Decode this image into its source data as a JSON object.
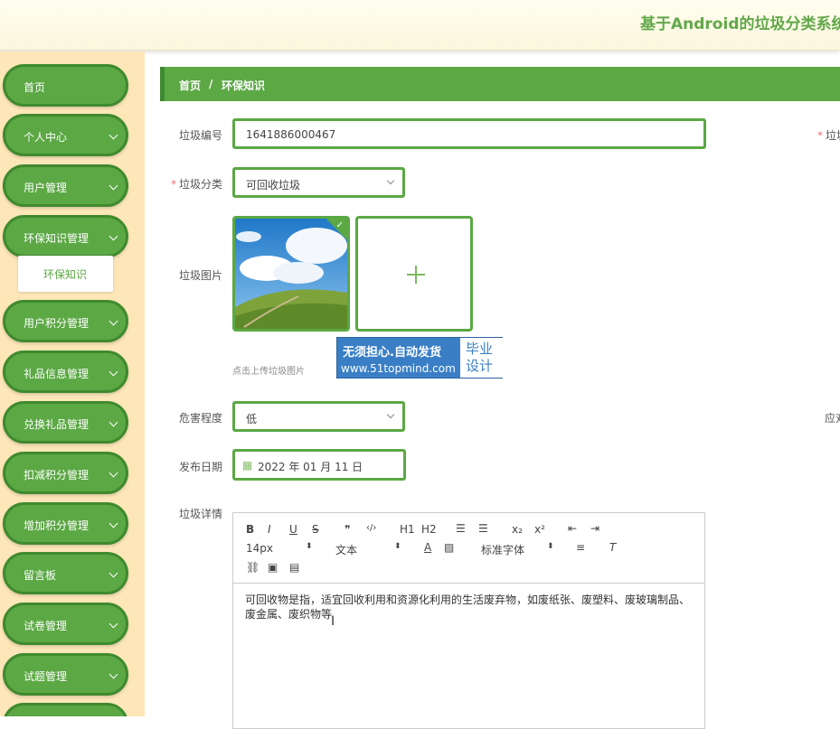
{
  "header": {
    "app_title": "基于Android的垃圾分类系统"
  },
  "sidebar": {
    "items": [
      {
        "label": "首页"
      },
      {
        "label": "个人中心"
      },
      {
        "label": "用户管理"
      },
      {
        "label": "环保知识管理"
      },
      {
        "label": "用户积分管理"
      },
      {
        "label": "礼品信息管理"
      },
      {
        "label": "兑换礼品管理"
      },
      {
        "label": "扣减积分管理"
      },
      {
        "label": "增加积分管理"
      },
      {
        "label": "留言板"
      },
      {
        "label": "试卷管理"
      },
      {
        "label": "试题管理"
      }
    ],
    "sub_item": "环保知识"
  },
  "breadcrumb": {
    "home": "首页",
    "sep": "/",
    "current": "环保知识"
  },
  "form": {
    "number": {
      "label": "垃圾编号",
      "value": "1641886000467"
    },
    "category": {
      "label": "垃圾分类",
      "value": "可回收垃圾"
    },
    "image": {
      "label": "垃圾图片",
      "tip": "点击上传垃圾图片"
    },
    "hazard": {
      "label": "危害程度",
      "value": "低"
    },
    "date": {
      "label": "发布日期",
      "value": "2022 年 01 月 11 日"
    },
    "detail": {
      "label": "垃圾详情"
    },
    "right_label_1": "垃圾",
    "right_label_2": "应对"
  },
  "editor": {
    "toolbar": {
      "bold": "B",
      "italic": "I",
      "underline": "U",
      "strike": "S",
      "quote": "❞",
      "code": "‹/›",
      "h1": "H1",
      "h2": "H2",
      "sub": "x₂",
      "sup": "x²",
      "size": "14px",
      "type": "文本",
      "font": "标准字体"
    },
    "content": "可回收物是指，适宜回收利用和资源化利用的生活废弃物，如废纸张、废塑料、废玻璃制品、废金属、废织物等"
  },
  "watermark": {
    "line1": "无须担心.自动发货",
    "line2": "www.51topmind.com",
    "box": "毕业设计"
  }
}
